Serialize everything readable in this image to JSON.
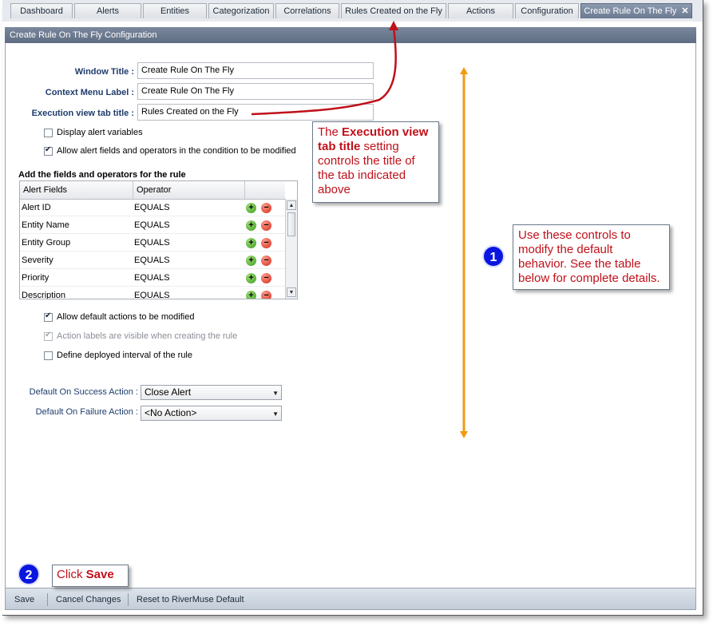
{
  "tabs": [
    {
      "label": "Dashboard"
    },
    {
      "label": "Alerts"
    },
    {
      "label": "Entities"
    },
    {
      "label": "Categorization"
    },
    {
      "label": "Correlations"
    },
    {
      "label": "Rules Created on the Fly"
    },
    {
      "label": "Actions"
    },
    {
      "label": "Configuration"
    },
    {
      "label": "Create Rule On The Fly",
      "active": true,
      "close_glyph": "✕"
    }
  ],
  "panel_title": "Create Rule On The Fly Configuration",
  "form": {
    "window_title_label": "Window Title :",
    "window_title_value": "Create Rule On The Fly",
    "context_menu_label": "Context Menu Label :",
    "context_menu_value": "Create Rule On The Fly",
    "execution_tab_label": "Execution view tab title :",
    "execution_tab_value": "Rules Created on the Fly",
    "display_alert_variables": "Display alert variables",
    "allow_alert_fields": "Allow alert fields and operators in the condition to be modified",
    "fields_section_title": "Add the fields and operators for the rule",
    "allow_default_actions": "Allow default actions to be modified",
    "action_labels_visible": "Action labels are visible when creating the rule",
    "define_deployed_interval": "Define deployed interval of the rule",
    "success_action_label": "Default On Success Action :",
    "success_action_value": "Close Alert",
    "failure_action_label": "Default On Failure Action :",
    "failure_action_value": "<No Action>"
  },
  "grid": {
    "col_fields": "Alert Fields",
    "col_operator": "Operator",
    "rows": [
      {
        "field": "Alert ID",
        "operator": "EQUALS"
      },
      {
        "field": "Entity Name",
        "operator": "EQUALS"
      },
      {
        "field": "Entity Group",
        "operator": "EQUALS"
      },
      {
        "field": "Severity",
        "operator": "EQUALS"
      },
      {
        "field": "Priority",
        "operator": "EQUALS"
      },
      {
        "field": "Description",
        "operator": "EQUALS"
      }
    ],
    "add_glyph": "+",
    "remove_glyph": "−",
    "scroll_up_glyph": "▲",
    "scroll_down_glyph": "▼"
  },
  "bottombar": {
    "save": "Save",
    "cancel": "Cancel Changes",
    "reset": "Reset to RiverMuse Default"
  },
  "annotations": {
    "callout1_pre": "The ",
    "callout1_bold": "Execution view tab title",
    "callout1_post": " setting controls the title of the tab indicated above",
    "callout2": "Use these controls to modify the default behavior. See the table below for complete details.",
    "callout3_pre": "Click ",
    "callout3_bold": "Save",
    "badge1": "1",
    "badge2": "2"
  },
  "colors": {
    "annotation_red": "#c0101a",
    "badge_blue": "#0a16e0",
    "orange_bracket": "#f29a12",
    "arrow_red": "#c0101a"
  },
  "icons": {
    "add": "plus-circle-icon",
    "remove": "minus-circle-icon",
    "dropdown": "chevron-down-icon",
    "close": "close-icon"
  }
}
